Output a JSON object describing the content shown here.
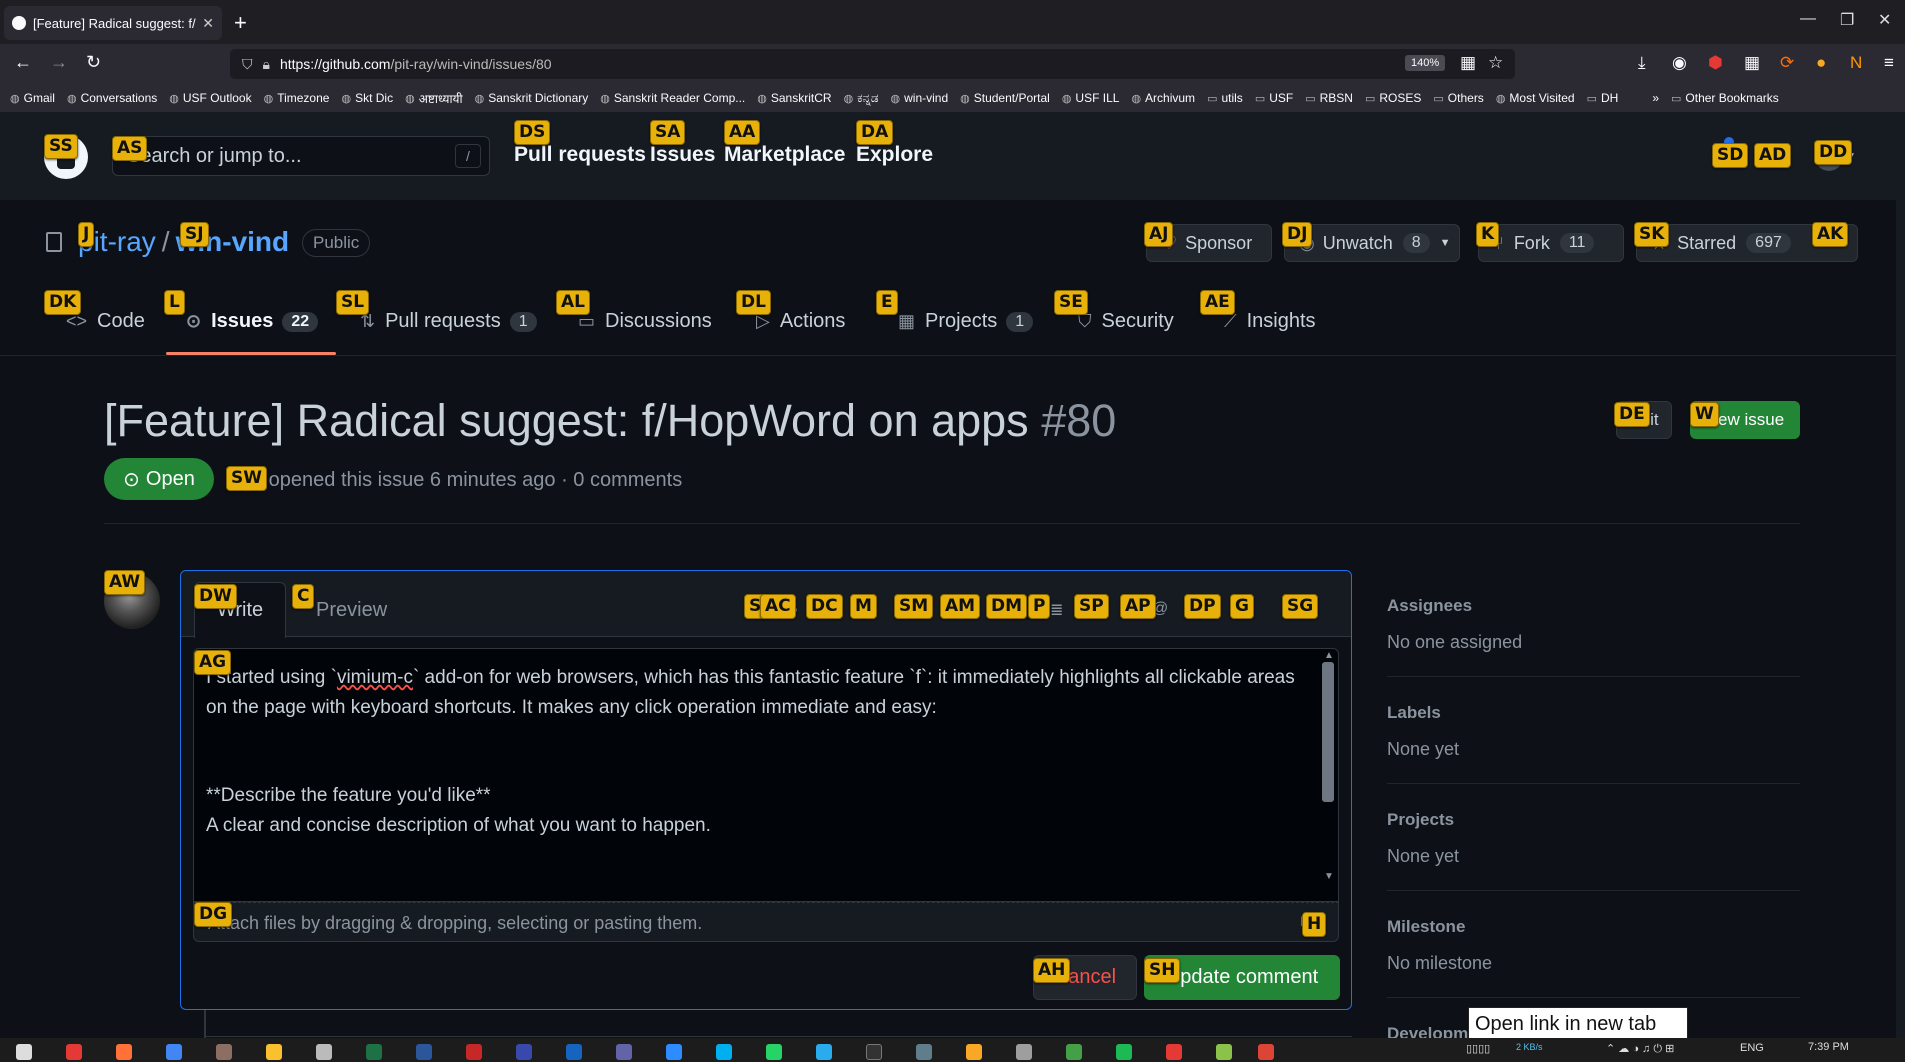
{
  "browser": {
    "tab_title": "[Feature] Radical suggest: f/Ho",
    "new_tab": "+",
    "url_host": "https://github.com",
    "url_path": "/pit-ray/win-vind/issues/80",
    "zoom": "140%",
    "bookmarks": [
      "Gmail",
      "Conversations",
      "USF Outlook",
      "Timezone",
      "Skt Dic",
      "अष्टाध्यायी",
      "Sanskrit Dictionary",
      "Sanskrit Reader Comp...",
      "SanskritCR",
      "ಕನ್ನಡ",
      "win-vind",
      "Student/Portal",
      "USF ILL",
      "Archivum",
      "utils",
      "USF",
      "RBSN",
      "ROSES",
      "Others",
      "Most Visited",
      "DH"
    ],
    "other_bookmarks": "Other Bookmarks",
    "overflow": "»"
  },
  "header": {
    "search_placeholder": "Search or jump to...",
    "slash": "/",
    "nav": [
      "Pull requests",
      "Issues",
      "Marketplace",
      "Explore"
    ]
  },
  "repo": {
    "owner": "pit-ray",
    "sep": "/",
    "name": "win-vind",
    "visibility": "Public",
    "sponsor": "Sponsor",
    "unwatch": "Unwatch",
    "watch_count": "8",
    "fork": "Fork",
    "fork_count": "11",
    "starred": "Starred",
    "star_count": "697",
    "tabs": [
      {
        "label": "Code",
        "count": ""
      },
      {
        "label": "Issues",
        "count": "22"
      },
      {
        "label": "Pull requests",
        "count": "1"
      },
      {
        "label": "Discussions",
        "count": ""
      },
      {
        "label": "Actions",
        "count": ""
      },
      {
        "label": "Projects",
        "count": "1"
      },
      {
        "label": "Security",
        "count": ""
      },
      {
        "label": "Insights",
        "count": ""
      }
    ]
  },
  "issue": {
    "title": "[Feature] Radical suggest: f/HopWord on apps",
    "number": "#80",
    "edit": "Edit",
    "new_issue": "New issue",
    "state": "Open",
    "meta": "n opened this issue 6 minutes ago · 0 comments"
  },
  "editor": {
    "write": "Write",
    "preview": "Preview",
    "body_p1a": "I started using `",
    "body_p1b": "vimium-c",
    "body_p1c": "` add-on for web browsers, which has this fantastic feature `f`: it immediately highlights all clickable areas on the page with keyboard shortcuts. It makes any click operation immediate and easy:",
    "body_p2": "\n\n\n**Describe the feature you'd like**\nA clear and concise description of what you want to happen.",
    "attach": "Attach files by dragging & dropping, selecting or pasting them.",
    "cancel": "Cancel",
    "update": "Update comment"
  },
  "sidebar": [
    {
      "heading": "Assignees",
      "value": "No one assigned"
    },
    {
      "heading": "Labels",
      "value": "None yet"
    },
    {
      "heading": "Projects",
      "value": "None yet"
    },
    {
      "heading": "Milestone",
      "value": "No milestone"
    },
    {
      "heading": "Developm",
      "value": ""
    }
  ],
  "tooltip": "Open link in new tab",
  "hints": [
    "SS",
    "AS",
    "DS",
    "SA",
    "AA",
    "DA",
    "SD",
    "AD",
    "DD",
    "J",
    "SJ",
    "AJ",
    "DJ",
    "K",
    "SK",
    "AK",
    "DK",
    "L",
    "SL",
    "AL",
    "DL",
    "E",
    "SE",
    "AE",
    "DE",
    "W",
    "SW",
    "AW",
    "DW",
    "C",
    "S",
    "AC",
    "DC",
    "M",
    "SM",
    "AM",
    "DM",
    "P",
    "SP",
    "AP",
    "DP",
    "G",
    "SG",
    "AG",
    "DG",
    "H",
    "AH",
    "SH"
  ],
  "taskbar": {
    "net": "2 KB/s",
    "lang": "ENG",
    "time": "7:39 PM"
  },
  "colors": {
    "accent": "#1f6feb",
    "green": "#238636",
    "hint": "#e8b10a",
    "danger": "#f85149",
    "underline": "#f78166"
  }
}
